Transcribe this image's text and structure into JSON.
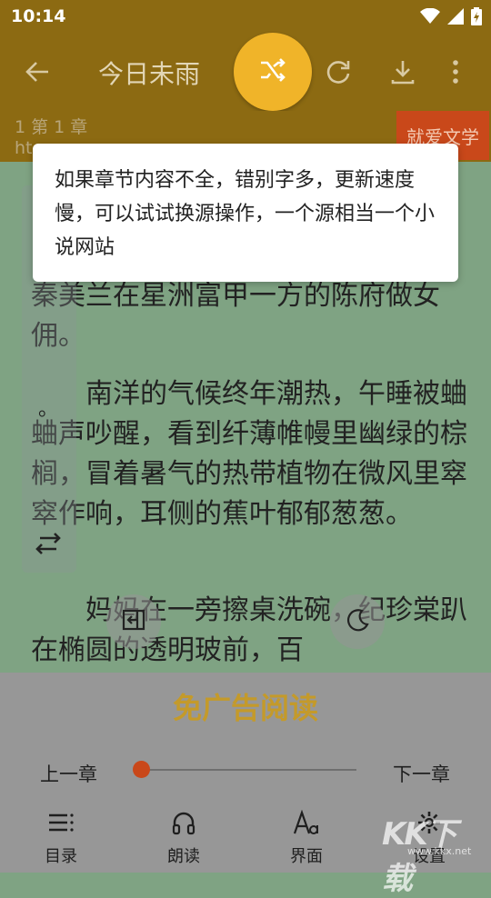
{
  "status_bar": {
    "time": "10:14"
  },
  "app_bar": {
    "title": "今日未雨"
  },
  "chapter": {
    "label": "1 第 1 章",
    "url_fragment": "ht",
    "source_button": "就爱文学"
  },
  "reading": {
    "paragraphs": [
      "秦美兰在星洲富甲一方的陈府做女佣。",
      "　　南洋的气候终年潮热，午睡被蛐蛐声吵醒，看到纤薄帷幔里幽绿的棕榈，冒着暑气的热带植物在微风里窣窣作响，耳侧的蕉叶郁郁葱葱。",
      "　　妈妈在一旁擦桌洗碗，纪珍棠趴在椭圆的透明玻前，百"
    ],
    "sidebar_glyph": "。"
  },
  "tooltip": {
    "text": "如果章节内容不全，错别字多，更新速度慢，可以试试换源操作，一个源相当一个小说网站"
  },
  "panel": {
    "banner": "免广告阅读",
    "prev_chapter": "上一章",
    "next_chapter": "下一章",
    "progress": 0.0,
    "nav": [
      {
        "label": "目录",
        "icon": "toc-icon"
      },
      {
        "label": "朗读",
        "icon": "headphones-icon"
      },
      {
        "label": "界面",
        "icon": "font-icon"
      },
      {
        "label": "设置",
        "icon": "gear-icon"
      }
    ]
  },
  "watermark": {
    "text": "KK下载",
    "url": "www.kkx.net"
  },
  "colors": {
    "header": "#8c6a12",
    "accent": "#f0b429",
    "source": "#c9481a",
    "page": "#7fa383",
    "panel": "#979797"
  }
}
